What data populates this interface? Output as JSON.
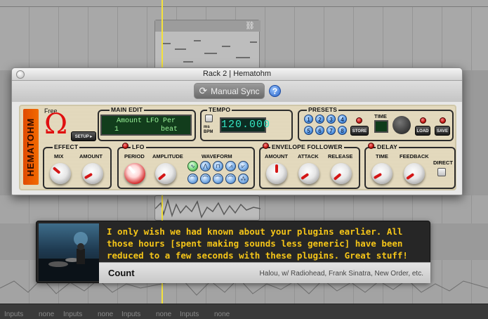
{
  "window": {
    "title": "Rack 2 | Hematohm",
    "sync_button": "Manual Sync",
    "help_label": "?"
  },
  "plugin": {
    "brand_vertical": "HEMATOHM",
    "free_label": "Free",
    "setup_label": "SETUP",
    "main_edit": {
      "title": "MAIN EDIT",
      "line1": "Amount LFO Per",
      "line2_value": "1",
      "line2_unit": "beat"
    },
    "tempo": {
      "title": "TEMPO",
      "mode_label": "ms BPM",
      "value": "120.000"
    },
    "presets": {
      "title": "PRESETS",
      "slots": [
        "1",
        "2",
        "3",
        "4",
        "5",
        "6",
        "7",
        "8"
      ],
      "store": "STORE",
      "time_label": "TIME",
      "load": "LOAD",
      "save": "SAVE"
    },
    "effect": {
      "title": "EFFECT",
      "mix": "MIX",
      "amount": "AMOUNT"
    },
    "lfo": {
      "title": "LFO",
      "period": "PERIOD",
      "amplitude": "AMPLITUDE",
      "waveform": "WAVEFORM"
    },
    "envelope": {
      "title": "ENVELOPE FOLLOWER",
      "amount": "AMOUNT",
      "attack": "ATTACK",
      "release": "RELEASE"
    },
    "delay": {
      "title": "DELAY",
      "time": "TIME",
      "feedback": "FEEDBACK",
      "direct": "DIRECT"
    }
  },
  "testimonial": {
    "quote": "I only wish we had known about your plugins earlier.  All those hours [spent making sounds less generic] have been reduced to a few seconds with these plugins. Great stuff!",
    "name": "Count",
    "credit": "Halou, w/ Radiohead, Frank Sinatra, New Order, etc."
  },
  "bottom_bar": [
    {
      "label": "Inputs",
      "value": "none"
    },
    {
      "label": "Inputs",
      "value": "none"
    },
    {
      "label": "Inputs",
      "value": "none"
    },
    {
      "label": "Inputs",
      "value": "none"
    }
  ],
  "colors": {
    "accent_red": "#d41616",
    "lcd_green": "#9cf59a",
    "quote_yellow": "#f5c518"
  }
}
